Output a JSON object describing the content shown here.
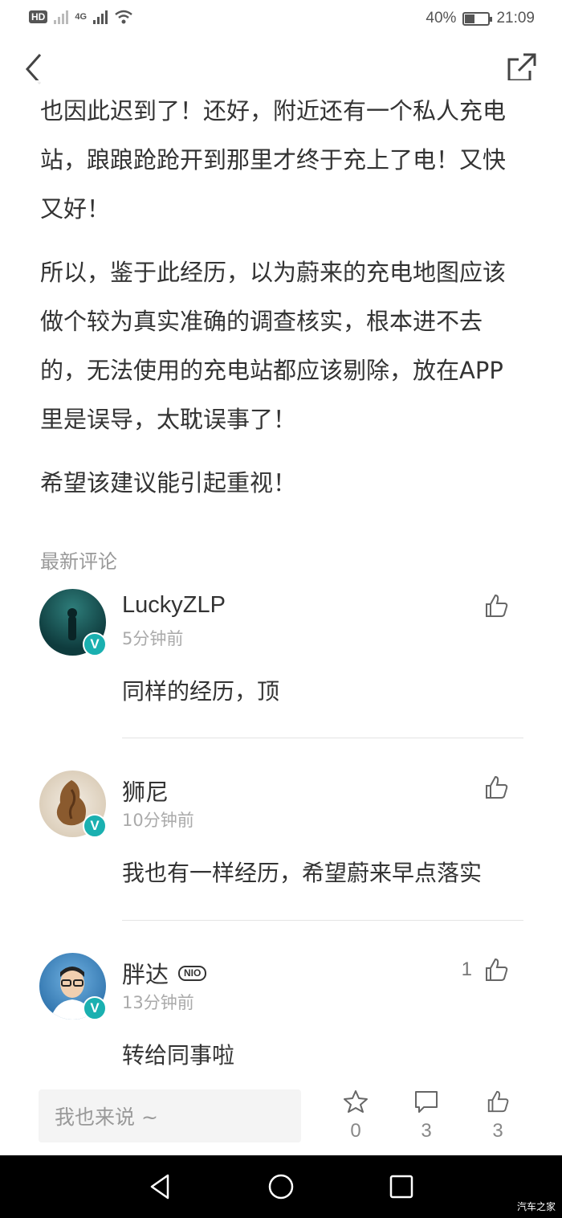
{
  "status_bar": {
    "hd": "HD",
    "network": "4G",
    "battery": "40%",
    "battery_level": 0.4,
    "time": "21:09"
  },
  "article": {
    "paragraphs": [
      "也因此迟到了！还好，附近还有一个私人充电站，踉踉跄跄开到那里才终于充上了电！又快又好！",
      "所以，鉴于此经历，以为蔚来的充电地图应该做个较为真实准确的调查核实，根本进不去的，无法使用的充电站都应该剔除，放在APP里是误导，太耽误事了！",
      "希望该建议能引起重视！"
    ]
  },
  "comments_section": {
    "title": "最新评论",
    "comments": [
      {
        "name": "LuckyZLP",
        "time": "5分钟前",
        "text": "同样的经历，顶",
        "likes": ""
      },
      {
        "name": "狮尼",
        "time": "10分钟前",
        "text": "我也有一样经历，希望蔚来早点落实",
        "likes": ""
      },
      {
        "name": "胖达",
        "badge": "NIO",
        "time": "13分钟前",
        "text": "转给同事啦",
        "likes": "1"
      }
    ],
    "verified_mark": "V"
  },
  "bottom_bar": {
    "placeholder": "我也来说 ~",
    "favorites": "0",
    "comments": "3",
    "likes": "3"
  },
  "watermark": "汽车之家",
  "icons": [
    "back-icon",
    "share-icon",
    "thumbs-up-icon",
    "star-icon",
    "comment-bubble-icon",
    "nav-back-icon",
    "nav-home-icon",
    "nav-recents-icon"
  ]
}
